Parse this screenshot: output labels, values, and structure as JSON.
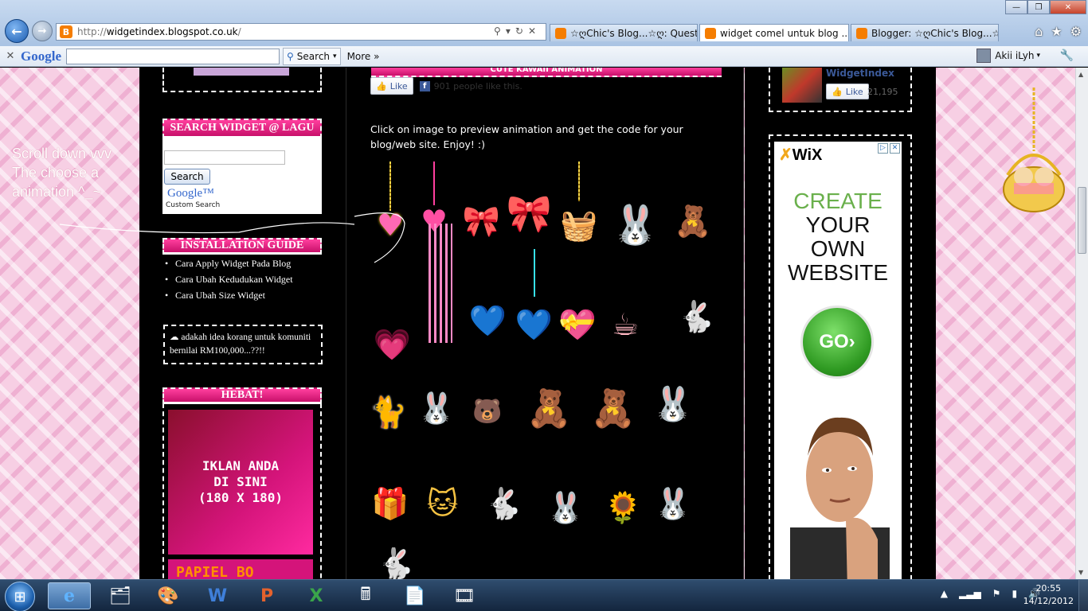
{
  "browser": {
    "url_prefix": "http://",
    "url_host": "widgetindex.blogspot.co.uk",
    "url_suffix": "/",
    "tabs": [
      {
        "label": "☆ღChic's Blog...☆ღ: Questi...",
        "active": false
      },
      {
        "label": "widget comel untuk blog ...",
        "active": true
      },
      {
        "label": "Blogger: ☆ღChic's Blog...☆..",
        "active": false
      }
    ],
    "tab_close": "×",
    "window_controls": {
      "minimize": "—",
      "maximize": "❐",
      "close": "✕"
    }
  },
  "toolbar": {
    "close": "✕",
    "google_logo": "Google",
    "search_label": "Search",
    "more_label": "More »",
    "user_name": "Akii iLyh"
  },
  "page": {
    "scroll_note": "Scroll down vvv\nThe choose a\nanimation ^_~",
    "left": {
      "search_title": "SEARCH WIDGET @ LAGU",
      "search_button": "Search",
      "google_brand": "Google™",
      "custom_search": "Custom Search",
      "install_title": "INSTALLATION GUIDE",
      "install_links": [
        "Cara Apply Widget Pada Blog",
        "Cara Ubah Kedudukan Widget",
        "Cara Ubah Size Widget"
      ],
      "idea_text": "adakah idea korang untuk komuniti bernilai RM100,000...??!!",
      "hebat_title": "HEBAT!",
      "ad_text": "IKLAN ANDA\nDI SINI\n(180 X 180)",
      "ad_text2": "PAPIEL BO"
    },
    "main": {
      "banner_title": "CUTE KAWAII ANIMATION",
      "like_label": "Like",
      "like_count": "901 people like this.",
      "intro": "Click on image to preview animation and get the code for your blog/web site. Enjoy! :)"
    },
    "right": {
      "fb_name": "WidgetIndex",
      "fb_like": "Like",
      "fb_count": "21,195",
      "wix_logo": "WiX",
      "wix_line1": "CREATE",
      "wix_line2": "YOUR",
      "wix_line3": "OWN",
      "wix_line4": "WEBSITE",
      "wix_go": "GO›"
    }
  },
  "taskbar": {
    "time": "20:55",
    "date": "14/12/2012"
  },
  "colors": {
    "accent_pink": "#d4147a",
    "title_bar_blue": "#a9c3e3",
    "wix_green": "#6ab04c"
  }
}
